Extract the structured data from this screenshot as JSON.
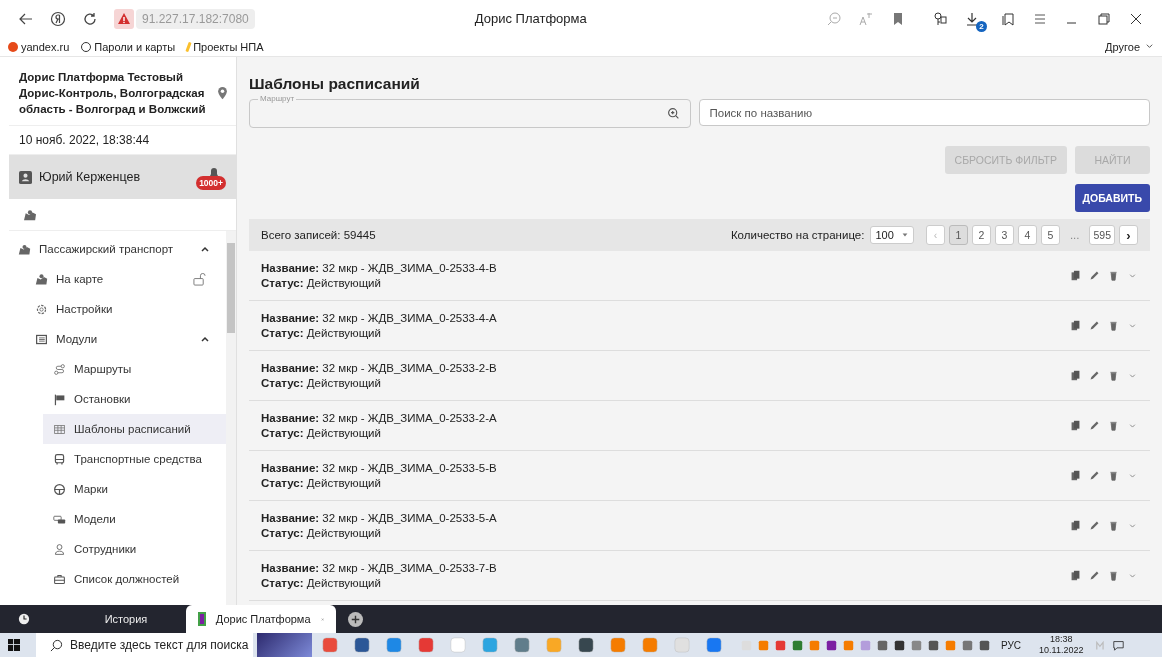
{
  "browser": {
    "address": "91.227.17.182:7080",
    "title": "Дорис Платформа",
    "downloads_badge": "2",
    "bookmarks": [
      "yandex.ru",
      "Пароли и карты",
      "Проекты НПА"
    ],
    "other_bookmarks": "Другое"
  },
  "sidebar": {
    "org": "Дорис Платформа Тестовый Дорис-Контроль, Волгоградская область - Волгоград и Волжский",
    "datetime": "10 нояб. 2022, 18:38:44",
    "user": "Юрий Керженцев",
    "notifications": "1000+",
    "nav": [
      {
        "label": "Пассажирский транспорт",
        "expanded": true,
        "selected": false,
        "children": [
          {
            "label": "На карте",
            "selected": false
          },
          {
            "label": "Настройки",
            "selected": false
          },
          {
            "label": "Модули",
            "expanded": true,
            "selected": false,
            "children": [
              {
                "label": "Маршруты",
                "selected": false
              },
              {
                "label": "Остановки",
                "selected": false
              },
              {
                "label": "Шаблоны расписаний",
                "selected": true
              },
              {
                "label": "Транспортные средства",
                "selected": false
              },
              {
                "label": "Марки",
                "selected": false
              },
              {
                "label": "Модели",
                "selected": false
              },
              {
                "label": "Сотрудники",
                "selected": false
              },
              {
                "label": "Список должностей",
                "selected": false
              }
            ]
          }
        ]
      }
    ]
  },
  "page": {
    "title": "Шаблоны расписаний",
    "route_field": {
      "label": "Маршрут"
    },
    "search_field": {
      "placeholder": "Поиск по названию"
    },
    "buttons": [
      {
        "label": "СБРОСИТЬ ФИЛЬТР",
        "disabled": true
      },
      {
        "label": "НАЙТИ",
        "disabled": true
      }
    ],
    "add_button": "ДОБАВИТЬ",
    "total": "Всего записей: 59445",
    "per_page_label": "Количество на странице:",
    "per_page": "100",
    "prev": {
      "label": "‹",
      "disabled": true
    },
    "next": {
      "label": "›",
      "disabled": false
    },
    "pages": [
      {
        "label": "1",
        "selected": true
      },
      {
        "label": "2",
        "selected": false
      },
      {
        "label": "3",
        "selected": false
      },
      {
        "label": "4",
        "selected": false
      },
      {
        "label": "5",
        "selected": false
      }
    ],
    "ellipsis": "...",
    "last_page": "595",
    "items": [
      {
        "name": "**Название:** 32 мкр - ЖДВ_ЗИМА_0-2533-4-В",
        "status": "**Статус:** Действующий"
      },
      {
        "name": "**Название:** 32 мкр - ЖДВ_ЗИМА_0-2533-4-А",
        "status": "**Статус:** Действующий"
      },
      {
        "name": "**Название:** 32 мкр - ЖДВ_ЗИМА_0-2533-2-В",
        "status": "**Статус:** Действующий"
      },
      {
        "name": "**Название:** 32 мкр - ЖДВ_ЗИМА_0-2533-2-А",
        "status": "**Статус:** Действующий"
      },
      {
        "name": "**Название:** 32 мкр - ЖДВ_ЗИМА_0-2533-5-В",
        "status": "**Статус:** Действующий"
      },
      {
        "name": "**Название:** 32 мкр - ЖДВ_ЗИМА_0-2533-5-А",
        "status": "**Статус:** Действующий"
      },
      {
        "name": "**Название:** 32 мкр - ЖДВ_ЗИМА_0-2533-7-В",
        "status": "**Статус:** Действующий"
      }
    ]
  },
  "tabs": [
    {
      "label": "История",
      "selected": false
    },
    {
      "label": "Дорис Платформа",
      "selected": true
    }
  ],
  "taskbar": {
    "search_placeholder": "Введите здесь текст для поиска",
    "language": "РУС",
    "time": "18:38",
    "date": "10.11.2022"
  }
}
